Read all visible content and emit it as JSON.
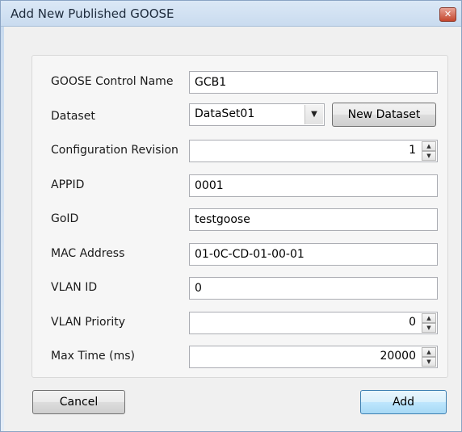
{
  "window": {
    "title": "Add New Published GOOSE",
    "close_glyph": "✕"
  },
  "form": {
    "goose_control_name": {
      "label": "GOOSE Control Name",
      "value": "GCB1"
    },
    "dataset": {
      "label": "Dataset",
      "value": "DataSet01",
      "arrow": "▼",
      "new_button": "New Dataset"
    },
    "configuration_revision": {
      "label": "Configuration Revision",
      "value": "1"
    },
    "appid": {
      "label": "APPID",
      "value": "0001"
    },
    "goid": {
      "label": "GoID",
      "value": "testgoose"
    },
    "mac_address": {
      "label": "MAC Address",
      "value": "01-0C-CD-01-00-01"
    },
    "vlan_id": {
      "label": "VLAN ID",
      "value": "0"
    },
    "vlan_priority": {
      "label": "VLAN Priority",
      "value": "0"
    },
    "max_time": {
      "label": "Max Time (ms)",
      "value": "20000"
    }
  },
  "spin": {
    "up": "▲",
    "down": "▼"
  },
  "buttons": {
    "cancel": "Cancel",
    "add": "Add"
  }
}
